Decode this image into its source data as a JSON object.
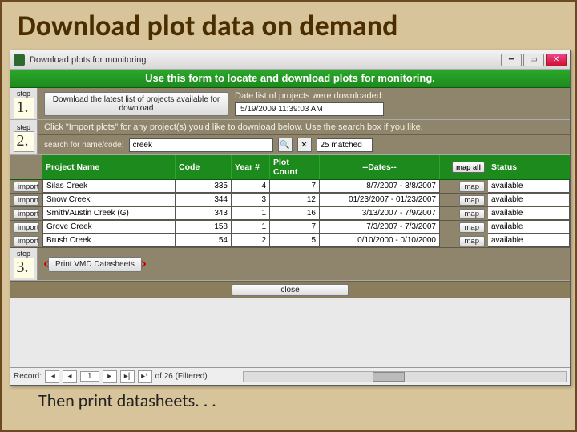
{
  "slide": {
    "title": "Download plot data on demand",
    "footer": "Then print datasheets. . ."
  },
  "window": {
    "title": "Download plots for monitoring",
    "greenBanner": "Use this form to locate and download plots for monitoring."
  },
  "step_label": "step",
  "step1": {
    "num": "1.",
    "button": "Download the latest list of projects\navailable for download",
    "dateLabel": "Date list of projects were downloaded:",
    "dateValue": "5/19/2009 11:39:03 AM"
  },
  "step2": {
    "num": "2.",
    "hint": "Click \"Import plots\" for any project(s) you'd like to download below.  Use the search box if you like.",
    "searchLabel": "search for name/code:",
    "searchValue": "creek",
    "matched": "25 matched",
    "headers": {
      "name": "Project Name",
      "code": "Code",
      "year": "Year #",
      "count": "Plot Count",
      "dates": "--Dates--",
      "mapall": "map all",
      "status": "Status"
    },
    "importLabel": "import",
    "mapLabel": "map",
    "rows": [
      {
        "name": "Silas Creek",
        "code": "335",
        "year": "4",
        "count": "7",
        "d1": "8/7/2007",
        "d2": "3/8/2007",
        "status": "available"
      },
      {
        "name": "Snow Creek",
        "code": "344",
        "year": "3",
        "count": "12",
        "d1": "01/23/2007",
        "d2": "01/23/2007",
        "status": "available"
      },
      {
        "name": "Smith/Austin Creek (G)",
        "code": "343",
        "year": "1",
        "count": "16",
        "d1": "3/13/2007",
        "d2": "7/9/2007",
        "status": "available"
      },
      {
        "name": "Grove Creek",
        "code": "158",
        "year": "1",
        "count": "7",
        "d1": "7/3/2007",
        "d2": "7/3/2007",
        "status": "available"
      },
      {
        "name": "Brush Creek",
        "code": "54",
        "year": "2",
        "count": "5",
        "d1": "0/10/2000",
        "d2": "0/10/2000",
        "status": "available"
      }
    ]
  },
  "step3": {
    "num": "3.",
    "button": "Print VMD Datasheets"
  },
  "closeLabel": "close",
  "recordNav": {
    "label": "Record:",
    "current": "1",
    "of": "of 26 (Filtered)"
  }
}
